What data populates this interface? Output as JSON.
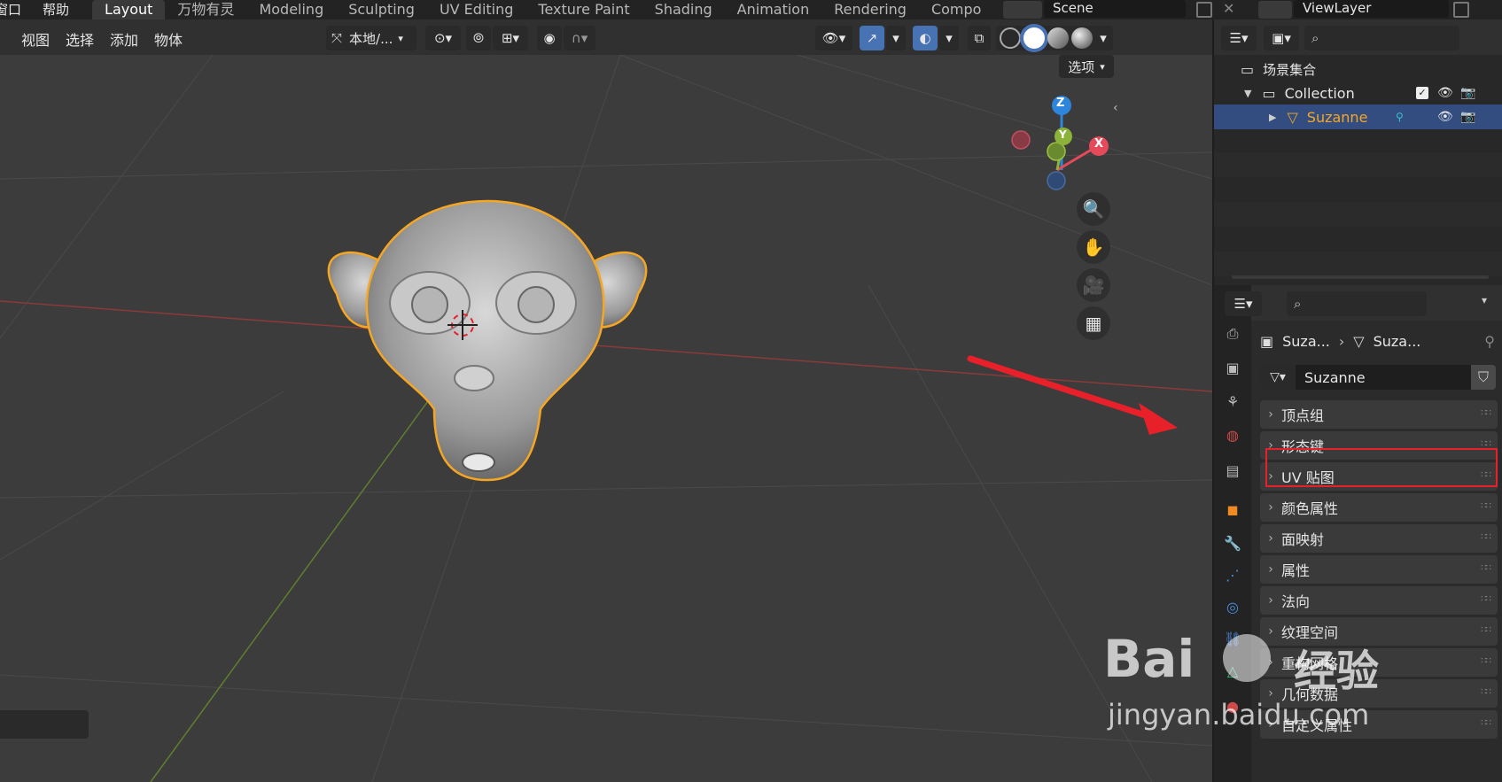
{
  "topbar": {
    "menus": [
      "窗口",
      "帮助"
    ],
    "workspaces": [
      "Layout",
      "万物有灵",
      "Modeling",
      "Sculpting",
      "UV Editing",
      "Texture Paint",
      "Shading",
      "Animation",
      "Rendering",
      "Compo"
    ],
    "active_workspace": "Layout",
    "scene": "Scene",
    "view_layer": "ViewLayer"
  },
  "viewport": {
    "menus": [
      "视图",
      "选择",
      "添加",
      "物体"
    ],
    "orientation": "本地/...",
    "options": "选项",
    "gizmo": {
      "z": "Z",
      "y": "Y",
      "x": "X"
    }
  },
  "outliner": {
    "root": "场景集合",
    "collection": "Collection",
    "object": "Suzanne"
  },
  "properties": {
    "breadcrumb_object": "Suza...",
    "breadcrumb_mesh": "Suza...",
    "mesh_name": "Suzanne",
    "panels": [
      "顶点组",
      "形态键",
      "UV 贴图",
      "颜色属性",
      "面映射",
      "属性",
      "法向",
      "纹理空间",
      "重构网格",
      "几何数据",
      "自定义属性"
    ],
    "highlighted_panel": "形态键"
  },
  "watermark": {
    "brand": "Bai",
    "brand_cn": "经验",
    "url": "jingyan.baidu.com"
  },
  "colors": {
    "accent": "#4772b3",
    "selection": "#334d80",
    "object_orange": "#f5a623",
    "annotation_red": "#e8202a",
    "axis_x": "#e54a5a",
    "axis_y": "#8bb33a",
    "axis_z": "#2d86dc"
  }
}
